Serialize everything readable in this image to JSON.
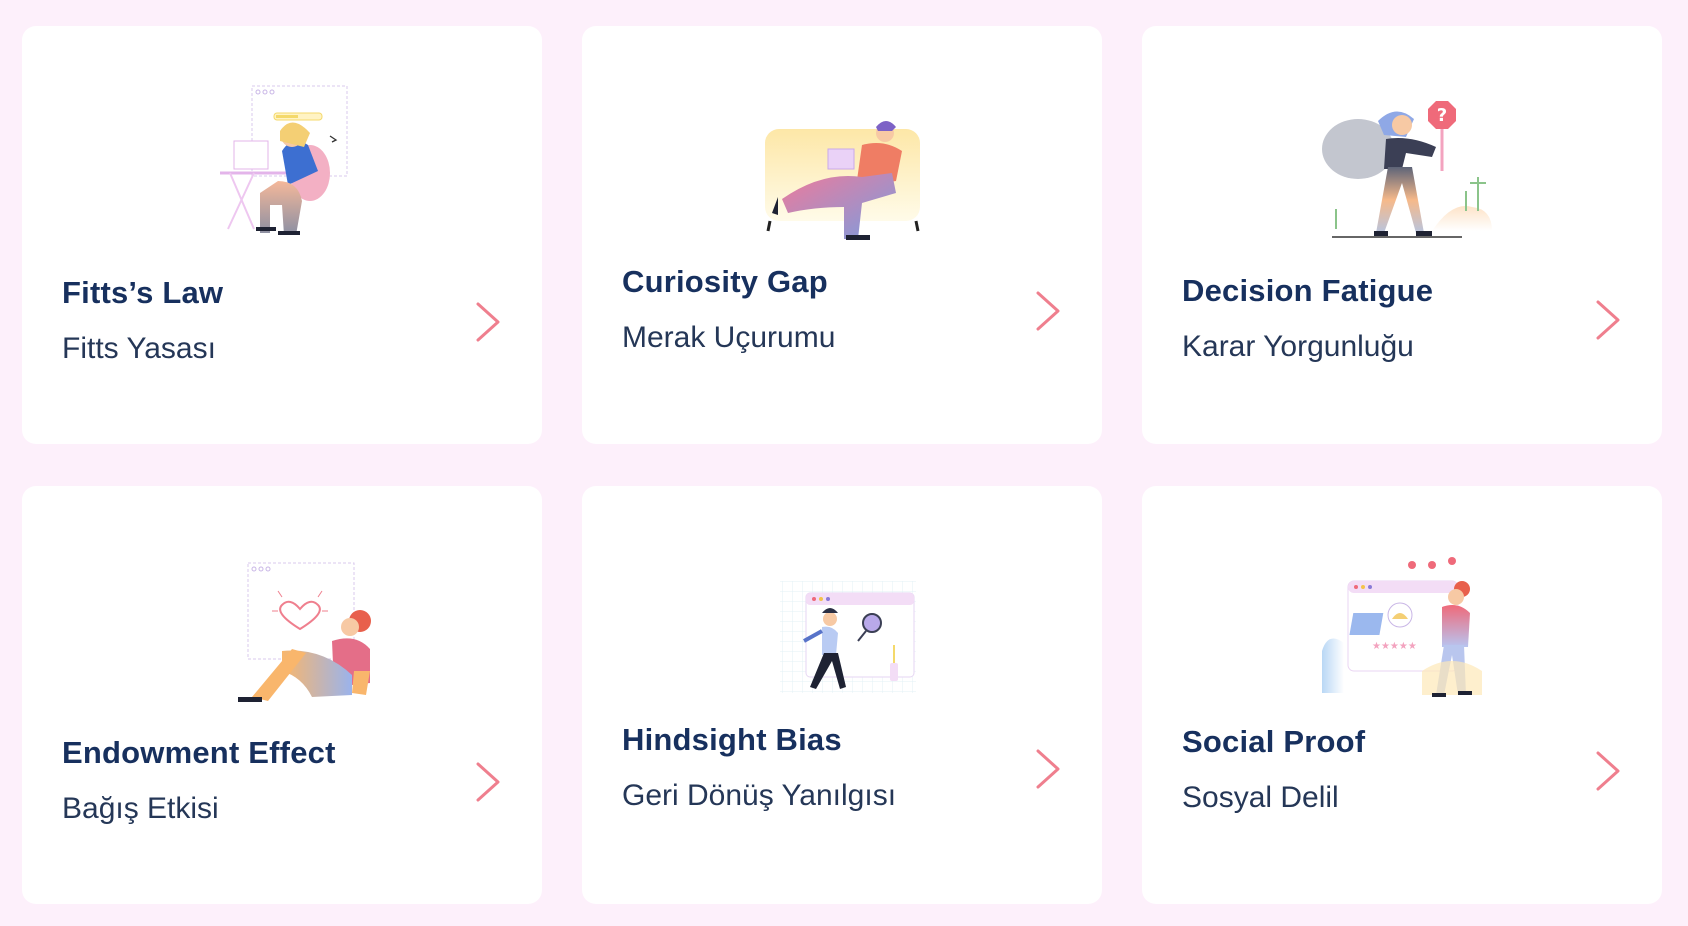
{
  "cards": [
    {
      "title": "Fitts’s Law",
      "subtitle": "Fitts Yasası",
      "illustration": "person-at-laptop-illustration",
      "chevron": "chevron-right-icon"
    },
    {
      "title": "Curiosity Gap",
      "subtitle": "Merak Uçurumu",
      "illustration": "person-on-sofa-illustration",
      "chevron": "chevron-right-icon"
    },
    {
      "title": "Decision Fatigue",
      "subtitle": "Karar Yorgunluğu",
      "illustration": "confused-person-sign-illustration",
      "chevron": "chevron-right-icon"
    },
    {
      "title": "Endowment Effect",
      "subtitle": "Bağış Etkisi",
      "illustration": "sitting-person-heart-illustration",
      "chevron": "chevron-right-icon"
    },
    {
      "title": "Hindsight Bias",
      "subtitle": "Geri Dönüş Yanılgısı",
      "illustration": "person-magnifier-illustration",
      "chevron": "chevron-right-icon"
    },
    {
      "title": "Social Proof",
      "subtitle": "Sosyal Delil",
      "illustration": "person-reviews-illustration",
      "chevron": "chevron-right-icon"
    }
  ],
  "colors": {
    "background": "#fdf0fb",
    "card": "#ffffff",
    "title": "#17305e",
    "subtitle": "#253757",
    "chevron": "#ef7f8e"
  }
}
